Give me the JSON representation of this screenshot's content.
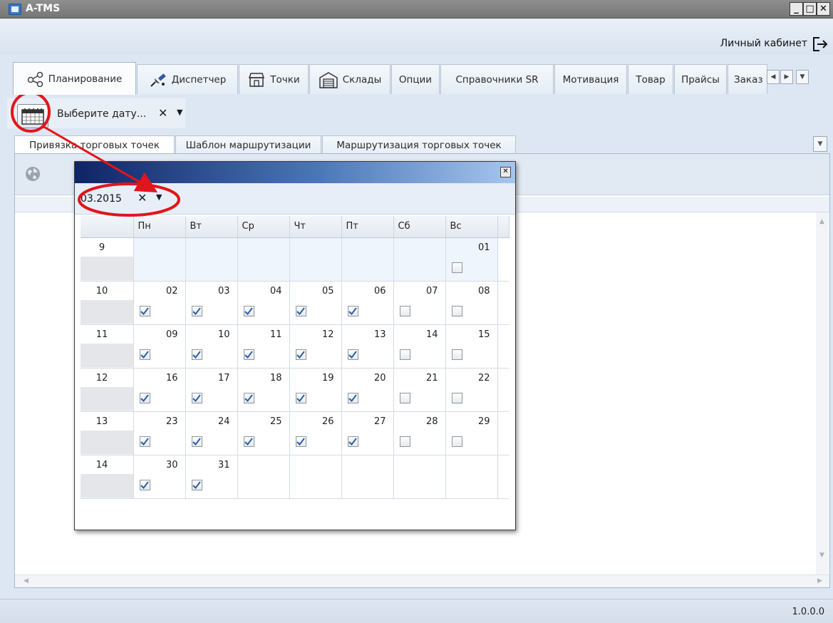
{
  "window": {
    "title": "A-TMS",
    "min_glyph": "_",
    "max_glyph": "□",
    "close_glyph": "✕"
  },
  "account": {
    "label": "Личный кабинет"
  },
  "main_tabs": [
    {
      "label": "Планирование",
      "icon": "share-nodes-icon"
    },
    {
      "label": "Диспетчер",
      "icon": "satellite-icon"
    },
    {
      "label": "Точки",
      "icon": "store-icon"
    },
    {
      "label": "Склады",
      "icon": "warehouse-icon"
    },
    {
      "label": "Опции"
    },
    {
      "label": "Справочники SR"
    },
    {
      "label": "Мотивация"
    },
    {
      "label": "Товар"
    },
    {
      "label": "Прайсы"
    },
    {
      "label": "Заказ"
    }
  ],
  "date_picker": {
    "placeholder": "Выберите дату...",
    "clear": "✕",
    "dropdown": "▼"
  },
  "sub_tabs": [
    {
      "label": "Привязка торговых точек"
    },
    {
      "label": "Шаблон маршрутизации"
    },
    {
      "label": "Маршрутизация торговых точек"
    }
  ],
  "popup": {
    "close_glyph": "✕",
    "month_value": "03.2015",
    "month_clear": "✕",
    "month_dropdown": "▼",
    "weekdays": [
      "Пн",
      "Вт",
      "Ср",
      "Чт",
      "Пт",
      "Сб",
      "Вс"
    ],
    "weeks": [
      {
        "num": "9",
        "days": [
          null,
          null,
          null,
          null,
          null,
          null,
          {
            "d": "01",
            "checked": false
          }
        ]
      },
      {
        "num": "10",
        "days": [
          {
            "d": "02",
            "checked": true
          },
          {
            "d": "03",
            "checked": true
          },
          {
            "d": "04",
            "checked": true
          },
          {
            "d": "05",
            "checked": true
          },
          {
            "d": "06",
            "checked": true
          },
          {
            "d": "07",
            "checked": false
          },
          {
            "d": "08",
            "checked": false
          }
        ]
      },
      {
        "num": "11",
        "days": [
          {
            "d": "09",
            "checked": true
          },
          {
            "d": "10",
            "checked": true
          },
          {
            "d": "11",
            "checked": true
          },
          {
            "d": "12",
            "checked": true
          },
          {
            "d": "13",
            "checked": true
          },
          {
            "d": "14",
            "checked": false
          },
          {
            "d": "15",
            "checked": false
          }
        ]
      },
      {
        "num": "12",
        "days": [
          {
            "d": "16",
            "checked": true
          },
          {
            "d": "17",
            "checked": true
          },
          {
            "d": "18",
            "checked": true
          },
          {
            "d": "19",
            "checked": true
          },
          {
            "d": "20",
            "checked": true
          },
          {
            "d": "21",
            "checked": false
          },
          {
            "d": "22",
            "checked": false
          }
        ]
      },
      {
        "num": "13",
        "days": [
          {
            "d": "23",
            "checked": true
          },
          {
            "d": "24",
            "checked": true
          },
          {
            "d": "25",
            "checked": true
          },
          {
            "d": "26",
            "checked": true
          },
          {
            "d": "27",
            "checked": true
          },
          {
            "d": "28",
            "checked": false
          },
          {
            "d": "29",
            "checked": false
          }
        ]
      },
      {
        "num": "14",
        "days": [
          {
            "d": "30",
            "checked": true
          },
          {
            "d": "31",
            "checked": true
          },
          null,
          null,
          null,
          null,
          null
        ]
      }
    ]
  },
  "status": {
    "version": "1.0.0.0"
  },
  "colors": {
    "annotation": "#e3141b",
    "checkmark": "#2a5fa8",
    "popup_title_start": "#0f2467",
    "popup_title_end": "#a6c6ee"
  }
}
